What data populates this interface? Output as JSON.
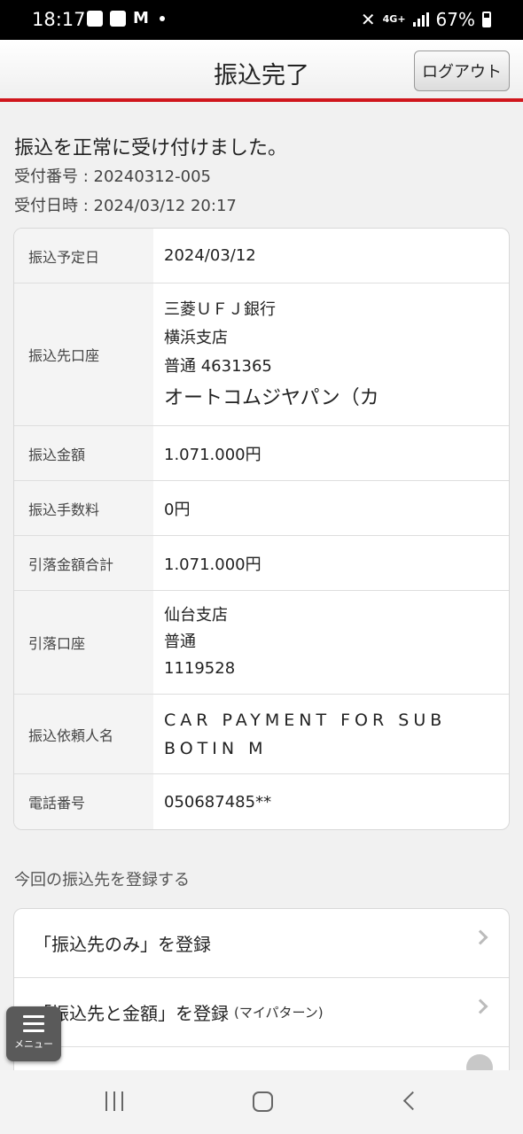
{
  "status_bar": {
    "time": "18:17",
    "network": "4G+",
    "battery": "67%"
  },
  "header": {
    "title": "振込完了",
    "logout_label": "ログアウト"
  },
  "confirmation": {
    "message": "振込を正常に受け付けました。",
    "receipt_number": "受付番号 : 20240312-005",
    "receipt_datetime": "受付日時 : 2024/03/12 20:17"
  },
  "details": {
    "transfer_date": {
      "label": "振込予定日",
      "value": "2024/03/12"
    },
    "payee_account": {
      "label": "振込先口座",
      "bank": "三菱ＵＦＪ銀行",
      "branch": "横浜支店",
      "account": "普通 4631365",
      "name": "オートコムジヤパン（カ"
    },
    "amount": {
      "label": "振込金額",
      "value": "1.071.000円"
    },
    "fee": {
      "label": "振込手数料",
      "value": "0円"
    },
    "total": {
      "label": "引落金額合計",
      "value": "1.071.000円"
    },
    "debit_account": {
      "label": "引落口座",
      "branch": "仙台支店",
      "type": "普通",
      "number": "1119528"
    },
    "requester": {
      "label": "振込依頼人名",
      "line1": "CAR PAYMENT FOR SUB",
      "line2": "BOTIN M"
    },
    "phone": {
      "label": "電話番号",
      "value": "050687485**"
    }
  },
  "register": {
    "section_label": "今回の振込先を登録する",
    "payee_only": "「振込先のみ」を登録",
    "payee_amount": "「振込先と金額」を登録",
    "payee_amount_sub": "(マイパターン)"
  },
  "menu": {
    "label": "メニュー"
  }
}
